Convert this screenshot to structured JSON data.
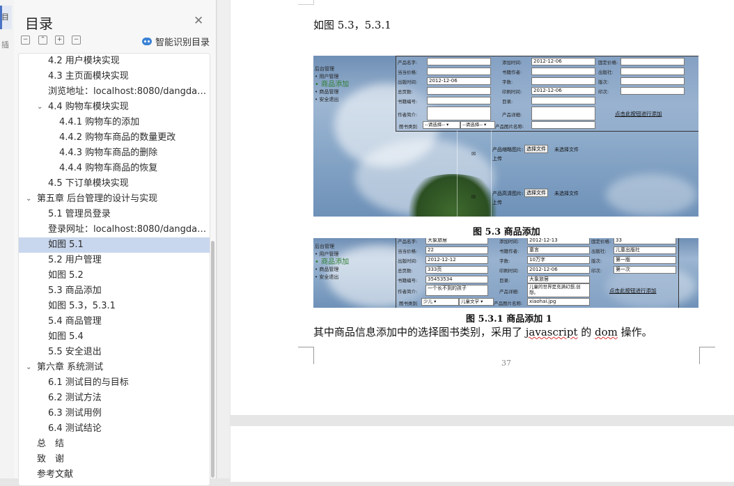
{
  "left_strip": {
    "tab1": "目",
    "tab2": "插"
  },
  "nav": {
    "title": "目录",
    "smart_label": "智能识别目录",
    "controls": [
      "−",
      "⌃",
      "+",
      "−"
    ],
    "items": [
      {
        "label": "4.2 用户模块实现",
        "level": 2,
        "chev": ""
      },
      {
        "label": "4.3 主页面模块实现",
        "level": 2,
        "chev": ""
      },
      {
        "label": "浏览地址：localhost:8080/dangda ...",
        "level": 2,
        "chev": ""
      },
      {
        "label": "4.4 购物车模块实现",
        "level": 2,
        "chev": "⌄"
      },
      {
        "label": "4.4.1 购物车的添加",
        "level": 3,
        "chev": ""
      },
      {
        "label": "4.4.2 购物车商品的数量更改",
        "level": 3,
        "chev": ""
      },
      {
        "label": "4.4.3 购物车商品的删除",
        "level": 3,
        "chev": ""
      },
      {
        "label": "4.4.4 购物车商品的恢复",
        "level": 3,
        "chev": ""
      },
      {
        "label": "4.5 下订单模块实现",
        "level": 2,
        "chev": ""
      },
      {
        "label": "第五章 后台管理的设计与实现",
        "level": 1,
        "chev": "⌄"
      },
      {
        "label": "5.1 管理员登录",
        "level": 2,
        "chev": ""
      },
      {
        "label": "登录网址：localhost:8080/dangda ...",
        "level": 2,
        "chev": ""
      },
      {
        "label": "如图 5.1",
        "level": 2,
        "chev": "",
        "selected": true
      },
      {
        "label": "5.2 用户管理",
        "level": 2,
        "chev": ""
      },
      {
        "label": "如图 5.2",
        "level": 2,
        "chev": ""
      },
      {
        "label": "5.3 商品添加",
        "level": 2,
        "chev": ""
      },
      {
        "label": "如图 5.3，5.3.1",
        "level": 2,
        "chev": ""
      },
      {
        "label": "5.4 商品管理",
        "level": 2,
        "chev": ""
      },
      {
        "label": "如图 5.4",
        "level": 2,
        "chev": ""
      },
      {
        "label": "5.5 安全退出",
        "level": 2,
        "chev": ""
      },
      {
        "label": "第六章 系统测试",
        "level": 1,
        "chev": "⌄"
      },
      {
        "label": "6.1 测试目的与目标",
        "level": 2,
        "chev": ""
      },
      {
        "label": "6.2 测试方法",
        "level": 2,
        "chev": ""
      },
      {
        "label": "6.3 测试用例",
        "level": 2,
        "chev": ""
      },
      {
        "label": "6.4 测试结论",
        "level": 2,
        "chev": ""
      },
      {
        "label": "总　结",
        "level": 1,
        "chev": ""
      },
      {
        "label": "致　谢",
        "level": 1,
        "chev": ""
      },
      {
        "label": "参考文献",
        "level": 1,
        "chev": ""
      }
    ]
  },
  "doc": {
    "heading": "如图 5.3，5.3.1",
    "caption1": "图 5.3 商品添加",
    "caption2": "图 5.3.1 商品添加 1",
    "body_prefix": "其中商品信息添加中的选择图书类别，采用了 ",
    "body_js": "javascript",
    "body_mid": " 的 ",
    "body_dom": "dom",
    "body_suffix": " 操作。",
    "page_number": "37"
  },
  "shot1": {
    "menu_header": "后台管理",
    "menu": [
      "用户管理",
      "商品添加",
      "商品管理",
      "安全退出"
    ],
    "labels": {
      "name": "产品名字:",
      "price_cur": "当当价格:",
      "pubdate": "出版时间:",
      "pages": "总页数:",
      "isbn": "书籍编号:",
      "author_intro": "作者简介:",
      "category": "图书类别",
      "add_time": "添加时间:",
      "author": "书籍作者:",
      "words": "字数:",
      "print_time": "印刷时间:",
      "catalog": "目录:",
      "detail": "产品详细:",
      "img_name": "产品图片名称:",
      "fixed_price": "固定价格:",
      "publisher": "出版社:",
      "edition": "版次:",
      "impression": "印次:"
    },
    "values": {
      "add_time": "2012-12-06",
      "pubdate": "2012-12-06",
      "print_time": "2012-12-06"
    },
    "select1": "--请选择--",
    "select2": "--请选择--",
    "submit_link": "点击此按钮进行添加",
    "small_img_label": "产品缩略图片:",
    "large_img_label": "产品高清图片:",
    "file_btn": "选择文件",
    "no_file": "未选择文件",
    "upload": "上传",
    "img_glyph": "☒"
  },
  "shot2": {
    "menu_header": "后台管理",
    "menu": [
      "用户管理",
      "商品添加",
      "商品管理",
      "安全退出"
    ],
    "values": {
      "name": "大象旅居",
      "price_cur": "22",
      "pubdate": "2012-12-12",
      "pages": "333页",
      "isbn": "35453534",
      "author_intro": "一个长不到的孩子",
      "add_time": "2012-12-13",
      "author": "童言",
      "words": "10万字",
      "print_time": "2012-12-06",
      "catalog": "大象旅居",
      "detail": "儿童的世界是充满幻想,创想。",
      "img_name": "xiaohai.jpg",
      "fixed_price": "33",
      "publisher": "儿童出版社",
      "edition": "第一版",
      "impression": "第一次"
    },
    "labels": {
      "name": "产品名字:",
      "price_cur": "当当价格:",
      "pubdate": "出版时间:",
      "pages": "总页数:",
      "isbn": "书籍编号:",
      "author_intro": "作者简介:",
      "category": "图书类别",
      "add_time": "添加时间:",
      "author": "书籍作者:",
      "words": "字数:",
      "print_time": "印刷时间:",
      "catalog": "目录:",
      "detail": "产品详细:",
      "img_name": "产品图片名称:",
      "fixed_price": "固定价格:",
      "publisher": "出版社:",
      "edition": "版次:",
      "impression": "印次:"
    },
    "select1": "少儿",
    "select2": "儿童文学",
    "submit_link": "点击此按钮进行添加"
  }
}
